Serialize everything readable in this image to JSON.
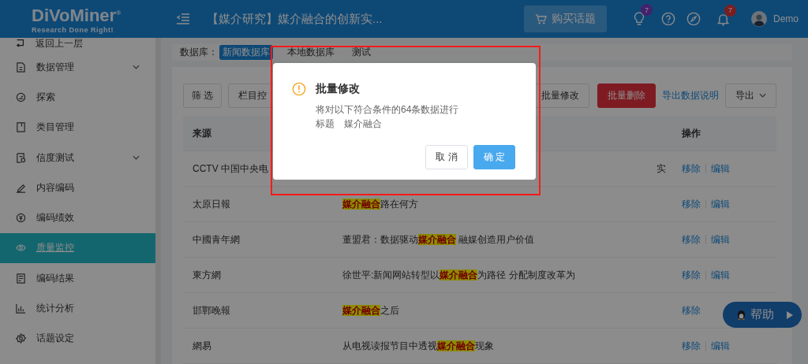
{
  "header": {
    "logo": "DiVoMiner",
    "logo_mark": "®",
    "tagline": "Research Done Right!",
    "title": "【媒介研究】媒介融合的创新实...",
    "buy_button": "购买话题",
    "bulb_badge": "7",
    "bell_badge": "7",
    "user": "Demo"
  },
  "sidebar": {
    "back": "返回上一层",
    "items": [
      {
        "label": "数据管理",
        "expandable": true,
        "selected": false
      },
      {
        "label": "探索",
        "expandable": false,
        "selected": false
      },
      {
        "label": "类目管理",
        "expandable": false,
        "selected": false
      },
      {
        "label": "信度测试",
        "expandable": true,
        "selected": false
      },
      {
        "label": "内容编码",
        "expandable": false,
        "selected": false
      },
      {
        "label": "编码绩效",
        "expandable": false,
        "selected": false
      },
      {
        "label": "质量监控",
        "expandable": false,
        "selected": true
      },
      {
        "label": "编码结果",
        "expandable": false,
        "selected": false
      },
      {
        "label": "统计分析",
        "expandable": false,
        "selected": false
      },
      {
        "label": "话题设定",
        "expandable": false,
        "selected": false
      }
    ]
  },
  "database": {
    "label": "数据库：",
    "tabs": [
      {
        "label": "新闻数据库",
        "selected": true
      },
      {
        "label": "本地数据库",
        "selected": false
      },
      {
        "label": "测试",
        "selected": false
      }
    ]
  },
  "toolbar": {
    "left": [
      "筛 选",
      "栏目控"
    ],
    "batch_edit": "批量修改",
    "batch_delete": "批量删除",
    "export_notes": "导出数据说明",
    "export": "导出"
  },
  "table": {
    "columns": {
      "source": "来源",
      "actions": "操作"
    },
    "rows": [
      {
        "source": "CCTV 中国中央电",
        "title_end": "实",
        "actions": [
          "移除",
          "编辑"
        ]
      },
      {
        "source": "太原日報",
        "title": {
          "highlight": "媒介融合",
          "after": "路在何方"
        },
        "actions": [
          "移除",
          "编辑"
        ]
      },
      {
        "source": "中國青年網",
        "title": {
          "before": "董盟君：数据驱动",
          "highlight": "媒介融合",
          "after": " 融媒创造用户价值"
        },
        "actions": [
          "移除",
          "编辑"
        ]
      },
      {
        "source": "東方網",
        "title": {
          "before": "徐世平:新闻网站转型以",
          "highlight": "媒介融合",
          "after": "为路径 分配制度改革为"
        },
        "actions": [
          "移除",
          "编辑"
        ]
      },
      {
        "source": "邯鄲晚報",
        "title": {
          "highlight": "媒介融合",
          "after": "之后"
        },
        "actions": [
          "移除"
        ]
      },
      {
        "source": "網易",
        "title": {
          "before": "从电视读报节目中透视",
          "highlight": "媒介融合",
          "after": "现象"
        },
        "actions": [
          "移除",
          "编辑"
        ]
      }
    ]
  },
  "help_button": "帮助",
  "modal": {
    "title": "批量修改",
    "lines": [
      "将对以下符合条件的64条数据进行",
      "标题　媒介融合"
    ],
    "cancel": "取 消",
    "confirm": "确 定"
  }
}
